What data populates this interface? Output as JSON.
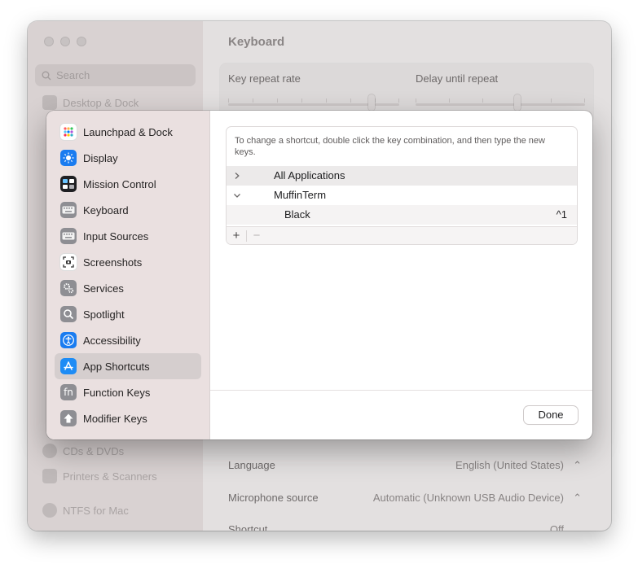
{
  "background": {
    "window_title": "Keyboard",
    "search_placeholder": "Search",
    "sidebar_items": [
      {
        "label": "Desktop & Dock"
      },
      {
        "label": "CDs & DVDs"
      },
      {
        "label": "Printers & Scanners"
      },
      {
        "label": "NTFS for Mac"
      }
    ],
    "key_repeat_label": "Key repeat rate",
    "delay_label": "Delay until repeat",
    "language_label": "Language",
    "language_value": "English (United States)",
    "microphone_label": "Microphone source",
    "microphone_value": "Automatic (Unknown USB Audio Device)",
    "shortcut_label": "Shortcut",
    "shortcut_value": "Off"
  },
  "sheet": {
    "sidebar_items": [
      {
        "label": "Launchpad & Dock",
        "icon": "launchpad-icon"
      },
      {
        "label": "Display",
        "icon": "display-icon"
      },
      {
        "label": "Mission Control",
        "icon": "mission-control-icon"
      },
      {
        "label": "Keyboard",
        "icon": "keyboard-icon"
      },
      {
        "label": "Input Sources",
        "icon": "input-sources-icon"
      },
      {
        "label": "Screenshots",
        "icon": "screenshots-icon"
      },
      {
        "label": "Services",
        "icon": "services-icon"
      },
      {
        "label": "Spotlight",
        "icon": "spotlight-icon"
      },
      {
        "label": "Accessibility",
        "icon": "accessibility-icon"
      },
      {
        "label": "App Shortcuts",
        "icon": "app-store-icon"
      },
      {
        "label": "Function Keys",
        "icon": "fn-icon"
      },
      {
        "label": "Modifier Keys",
        "icon": "modifier-keys-icon"
      }
    ],
    "selected_index": 9,
    "hint": "To change a shortcut, double click the key combination, and then type the new keys.",
    "rows": [
      {
        "label": "All Applications",
        "expanded": false
      },
      {
        "label": "MuffinTerm",
        "expanded": true
      },
      {
        "label": "Black",
        "shortcut": "^1"
      }
    ],
    "add_label": "+",
    "remove_label": "−",
    "done_label": "Done"
  }
}
